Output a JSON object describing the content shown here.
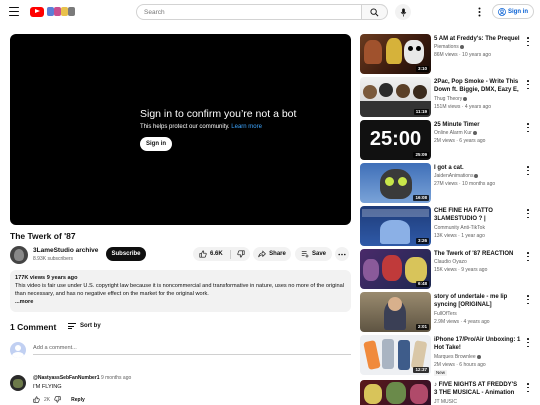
{
  "header": {
    "search_placeholder": "Search",
    "signin_label": "Sign in"
  },
  "player": {
    "message_title": "Sign in to confirm you’re not a bot",
    "message_sub": "This helps protect our community.",
    "learn_more": "Learn more",
    "signin_label": "Sign in"
  },
  "video": {
    "title": "The Twerk of '87",
    "channel": "3LameStudio archive",
    "subscribers": "8.93K subscribers",
    "subscribe_label": "Subscribe",
    "likes": "6.6K",
    "share_label": "Share",
    "save_label": "Save"
  },
  "description": {
    "meta": "177K views  9 years ago",
    "text": "This video is fair use under U.S. copyright law because it is noncommercial and transformative in nature, uses no more of the original than necessary, and has no negative effect on the market for the original work.",
    "more": "...more"
  },
  "comments": {
    "count_label": "1 Comment",
    "sort_label": "Sort by",
    "add_placeholder": "Add a comment...",
    "items": [
      {
        "author": "@NastyassSebFanNumber1",
        "ago": "9 months ago",
        "text": "I'M FLYING",
        "likes": "2K",
        "reply_label": "Reply"
      }
    ]
  },
  "recommendations": [
    {
      "title": "5 AM at Freddy's: The Prequel",
      "channel": "Piemations",
      "meta": "86M views · 10 years ago",
      "duration": "3:10"
    },
    {
      "title": "2Pac, Pop Smoke - Write This Down ft. Biggie, DMX, Eazy E, ...",
      "channel": "Thug Theory",
      "meta": "151M views · 4 years ago",
      "duration": "11:19"
    },
    {
      "title": "25 Minute Timer",
      "channel": "Online Alarm Kur",
      "meta": "2M views · 6 years ago",
      "duration": "25:09",
      "thumb_text": "25:00"
    },
    {
      "title": "I got a cat.",
      "channel": "JaidenAnimations",
      "meta": "27M views · 10 months ago",
      "duration": "16:08"
    },
    {
      "title": "CHE FINE HA FATTO 3LAMESTUDIO ? | COMMUNIT...",
      "channel": "Community Anti-TikTok",
      "meta": "13K views · 1 year ago",
      "duration": "3:26"
    },
    {
      "title": "The Twerk of '87 REACTION",
      "channel": "Claudio Oyazo",
      "meta": "15K views · 9 years ago",
      "duration": "6:48"
    },
    {
      "title": "story of undertale - me lip syncing [ORIGINAL]",
      "channel": "FullOfTers",
      "meta": "2.9M views · 4 years ago",
      "duration": "2:01"
    },
    {
      "title": "iPhone 17/Pro/Air Unboxing: 1 Hot Take!",
      "channel": "Marques Brownlee",
      "meta": "2M views · 6 hours ago",
      "duration": "12:37",
      "badge": "New"
    },
    {
      "title": "♪ FIVE NIGHTS AT FREDDY'S 3 THE MUSICAL - Animation Song",
      "channel": "JT MUSIC",
      "meta": "",
      "duration": ""
    }
  ],
  "colors": {
    "brand_red": "#ff0000",
    "link_blue": "#065fd4",
    "learn_more_blue": "#3ea6ff",
    "subscribe_bg": "#0f0f0f",
    "pill_bg": "#f2f2f2"
  }
}
